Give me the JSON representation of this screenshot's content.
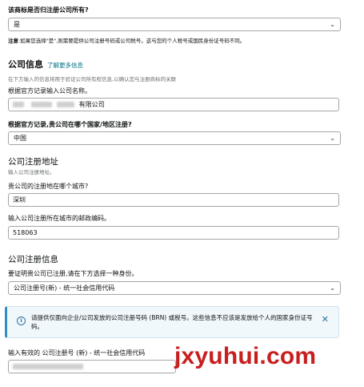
{
  "trademark_question": {
    "label": "该商标是否归注册公司所有?",
    "selected": "是",
    "note_prefix": "注意",
    "note_text": ":如果您选择\"是\",则需要提供公司注册号码或公司税号。这与您的个人税号或国民身份证号码不同。"
  },
  "company_info": {
    "heading": "公司信息",
    "learn_more": "了解更多信息",
    "description": "在下方输入的信息将用于验证公司所有权信息,以确认您与注册商标的关联",
    "name_label": "根据官方记录输入公司名称。",
    "name_value_suffix": "有限公司",
    "country_label": "根据官方记录,贵公司在哪个国家/地区注册?",
    "country_value": "中国"
  },
  "registered_address": {
    "heading": "公司注册地址",
    "hint": "输入公司注册地址。",
    "city_label": "贵公司的注册地在哪个城市?",
    "city_value": "深圳",
    "postal_label": "输入公司注册所在城市的邮政编码。",
    "postal_value": "518063"
  },
  "registration_info": {
    "heading": "公司注册信息",
    "id_type_label": "要证明贵公司已注册,请在下方选择一种身份。",
    "id_type_value": "公司注册号(新) - 统一社会信用代码",
    "alert_text": "请提供仅面向企业/公司发放的公司注册号码 (BRN) 或税号。这些信息不应该是发放给个人的国家身份证号码。",
    "input_label": "输入有效的 公司注册号 (新) - 统一社会信用代码"
  },
  "icons": {
    "chevron": "chevron-down-icon",
    "info": "info-icon",
    "close": "close-icon"
  },
  "watermark": "jxyuhui.com"
}
